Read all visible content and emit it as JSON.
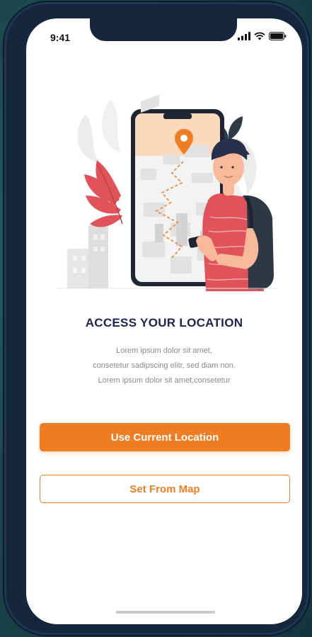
{
  "status_bar": {
    "time": "9:41",
    "icons": [
      "signal-icon",
      "wifi-icon",
      "battery-icon"
    ]
  },
  "illustration": {
    "description_icon": "location-illustration"
  },
  "content": {
    "title": "ACCESS YOUR LOCATION",
    "description_lines": [
      "Lorem ipsum dolor sit amet,",
      "consetetur sadipscing elitr, sed diam non.",
      "Lorem ipsum dolor sit amet,consetetur"
    ]
  },
  "actions": {
    "primary_label": "Use Current Location",
    "secondary_label": "Set From Map"
  },
  "colors": {
    "accent": "#ee7d23",
    "title": "#1c2550",
    "frame": "#14273d"
  }
}
